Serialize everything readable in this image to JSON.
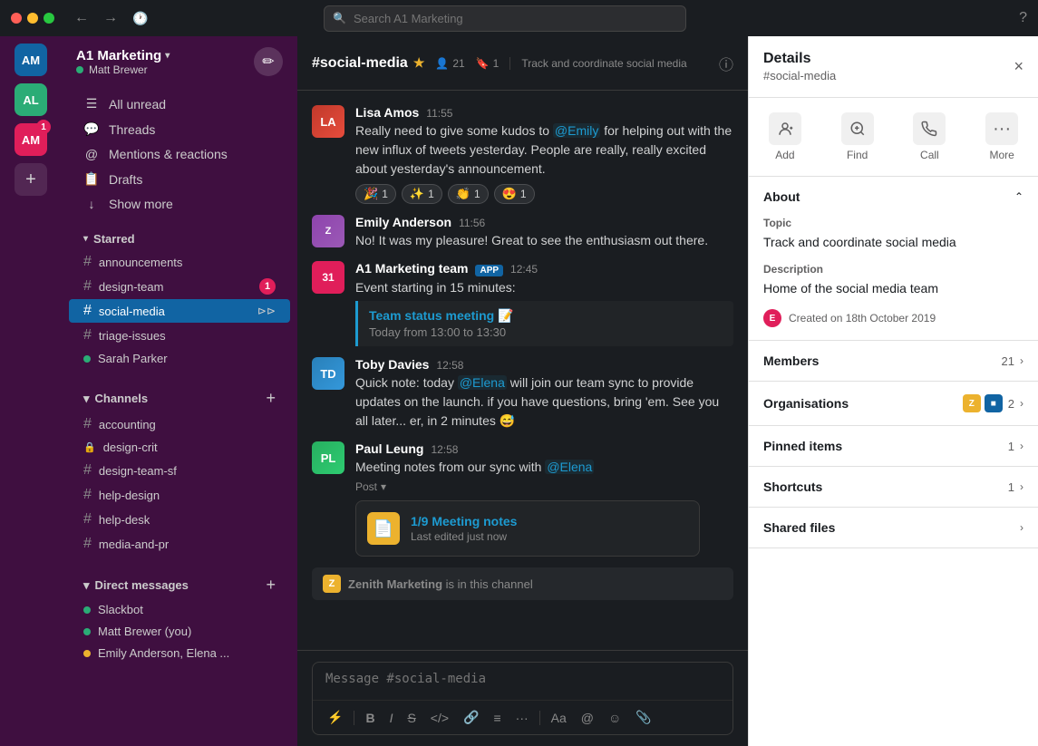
{
  "titlebar": {
    "search_placeholder": "Search A1 Marketing",
    "back_label": "←",
    "forward_label": "→"
  },
  "workspace": {
    "name": "A1 Marketing",
    "user": "Matt Brewer",
    "avatar_initials": "AM",
    "avatar_al": "AL"
  },
  "sidebar": {
    "all_unread": "All unread",
    "threads": "Threads",
    "mentions_reactions": "Mentions & reactions",
    "drafts": "Drafts",
    "show_more": "Show more",
    "starred_label": "Starred",
    "starred_channels": [
      {
        "name": "announcements",
        "type": "hash"
      },
      {
        "name": "design-team",
        "type": "hash",
        "badge": "1"
      },
      {
        "name": "social-media",
        "type": "hash",
        "active": true,
        "bookmark": true
      },
      {
        "name": "triage-issues",
        "type": "hash"
      },
      {
        "name": "Sarah Parker",
        "type": "dm",
        "dot": "green"
      }
    ],
    "channels_label": "Channels",
    "channels": [
      {
        "name": "accounting",
        "type": "hash"
      },
      {
        "name": "design-crit",
        "type": "lock"
      },
      {
        "name": "design-team-sf",
        "type": "hash"
      },
      {
        "name": "help-design",
        "type": "hash"
      },
      {
        "name": "help-desk",
        "type": "hash"
      },
      {
        "name": "media-and-pr",
        "type": "hash"
      }
    ],
    "dm_label": "Direct messages",
    "dms": [
      {
        "name": "Slackbot",
        "dot": "green"
      },
      {
        "name": "Matt Brewer (you)",
        "dot": "green"
      },
      {
        "name": "Emily Anderson, Elena ...",
        "dot": "yellow"
      }
    ]
  },
  "chat": {
    "channel_name": "#social-media",
    "members_count": "21",
    "bookmark_count": "1",
    "topic": "Track and coordinate social media",
    "messages": [
      {
        "id": "msg1",
        "author": "Lisa Amos",
        "time": "11:55",
        "text_before": "Really need to give some kudos to ",
        "mention": "@Emily",
        "text_after": " for helping out with the new influx of tweets yesterday. People are really, really excited about yesterday's announcement.",
        "reactions": [
          {
            "emoji": "🎉",
            "count": "1"
          },
          {
            "emoji": "✨",
            "count": "1"
          },
          {
            "emoji": "👏",
            "count": "1"
          },
          {
            "emoji": "😍",
            "count": "1"
          }
        ]
      },
      {
        "id": "msg2",
        "author": "Emily Anderson",
        "time": "11:56",
        "text": "No! It was my pleasure! Great to see the enthusiasm out there."
      },
      {
        "id": "msg3",
        "author": "A1 Marketing team",
        "app_badge": "APP",
        "time": "12:45",
        "text": "Event starting in 15 minutes:",
        "meeting": {
          "title": "Team status meeting 📝",
          "time": "Today from 13:00 to 13:30"
        }
      },
      {
        "id": "msg4",
        "author": "Toby Davies",
        "time": "12:58",
        "text_before": "Quick note: today ",
        "mention": "@Elena",
        "text_after": " will join our team sync to provide updates on the launch. if you have questions, bring 'em. See you all later... er, in 2 minutes 😅"
      },
      {
        "id": "msg5",
        "author": "Paul Leung",
        "time": "12:58",
        "text_before": "Meeting notes from our sync with ",
        "mention": "@Elena",
        "post_label": "Post",
        "file": {
          "name": "1/9 Meeting notes",
          "meta": "Last edited just now"
        }
      }
    ],
    "notification": "Zenith Marketing is in this channel",
    "input_placeholder": "Message #social-media"
  },
  "details": {
    "title": "Details",
    "channel_ref": "#social-media",
    "close_label": "×",
    "actions": [
      {
        "icon": "👤+",
        "label": "Add"
      },
      {
        "icon": "🔍",
        "label": "Find"
      },
      {
        "icon": "📞",
        "label": "Call"
      },
      {
        "icon": "···",
        "label": "More"
      }
    ],
    "about": {
      "title": "About",
      "topic_label": "Topic",
      "topic_value": "Track and coordinate social media",
      "description_label": "Description",
      "description_value": "Home of the social media team",
      "created": "Created on 18th October 2019"
    },
    "members": {
      "title": "Members",
      "count": "21"
    },
    "organisations": {
      "title": "Organisations",
      "count": "2"
    },
    "pinned": {
      "title": "Pinned items",
      "count": "1"
    },
    "shortcuts": {
      "title": "Shortcuts",
      "count": "1"
    },
    "shared_files": {
      "title": "Shared files"
    }
  },
  "toolbar": {
    "buttons": [
      "⚡",
      "B",
      "I",
      "S",
      "</>",
      "🔗",
      "≡",
      "···",
      "Aa",
      "@",
      "☺",
      "📎"
    ]
  }
}
